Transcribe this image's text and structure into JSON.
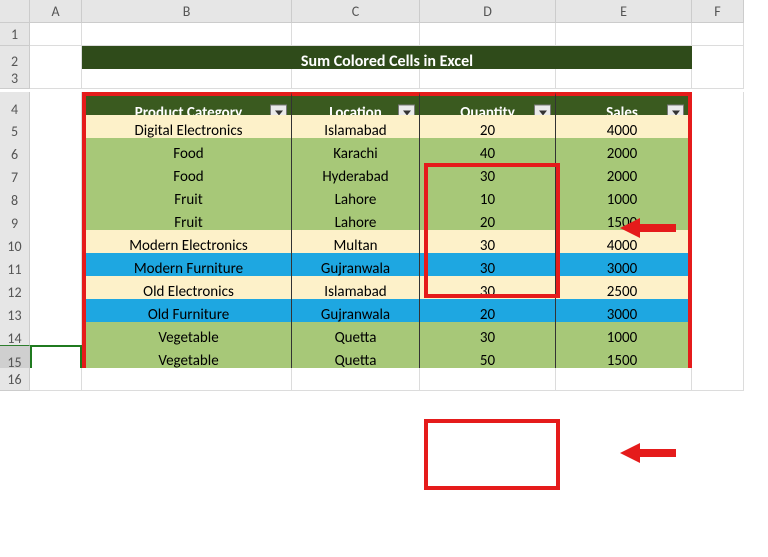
{
  "title": "Sum Colored Cells in Excel",
  "columns": [
    "",
    "A",
    "B",
    "C",
    "D",
    "E",
    "F"
  ],
  "row_indices": [
    "1",
    "2",
    "3",
    "4",
    "5",
    "6",
    "7",
    "8",
    "9",
    "10",
    "11",
    "12",
    "13",
    "14",
    "15",
    "16"
  ],
  "headers": {
    "b": "Product Category",
    "c": "Location",
    "d": "Quantity",
    "e": "Sales"
  },
  "rows": [
    {
      "cat": "Digital Electronics",
      "loc": "Islamabad",
      "qty": "20",
      "sales": "4000",
      "fill": "cream"
    },
    {
      "cat": "Food",
      "loc": "Karachi",
      "qty": "40",
      "sales": "2000",
      "fill": "green"
    },
    {
      "cat": "Food",
      "loc": "Hyderabad",
      "qty": "30",
      "sales": "2000",
      "fill": "green"
    },
    {
      "cat": "Fruit",
      "loc": "Lahore",
      "qty": "10",
      "sales": "1000",
      "fill": "green"
    },
    {
      "cat": "Fruit",
      "loc": "Lahore",
      "qty": "20",
      "sales": "1500",
      "fill": "green"
    },
    {
      "cat": "Modern Electronics",
      "loc": "Multan",
      "qty": "30",
      "sales": "4000",
      "fill": "cream"
    },
    {
      "cat": "Modern Furniture",
      "loc": "Gujranwala",
      "qty": "30",
      "sales": "3000",
      "fill": "blue"
    },
    {
      "cat": "Old Electronics",
      "loc": "Islamabad",
      "qty": "30",
      "sales": "2500",
      "fill": "cream"
    },
    {
      "cat": "Old Furniture",
      "loc": "Gujranwala",
      "qty": "20",
      "sales": "3000",
      "fill": "blue"
    },
    {
      "cat": "Vegetable",
      "loc": "Quetta",
      "qty": "30",
      "sales": "1000",
      "fill": "green"
    },
    {
      "cat": "Vegetable",
      "loc": "Quetta",
      "qty": "50",
      "sales": "1500",
      "fill": "green"
    }
  ],
  "chart_data": {
    "type": "table",
    "title": "Sum Colored Cells in Excel",
    "columns": [
      "Product Category",
      "Location",
      "Quantity",
      "Sales"
    ],
    "rows": [
      [
        "Digital Electronics",
        "Islamabad",
        20,
        4000
      ],
      [
        "Food",
        "Karachi",
        40,
        2000
      ],
      [
        "Food",
        "Hyderabad",
        30,
        2000
      ],
      [
        "Fruit",
        "Lahore",
        10,
        1000
      ],
      [
        "Fruit",
        "Lahore",
        20,
        1500
      ],
      [
        "Modern Electronics",
        "Multan",
        30,
        4000
      ],
      [
        "Modern Furniture",
        "Gujranwala",
        30,
        3000
      ],
      [
        "Old Electronics",
        "Islamabad",
        30,
        2500
      ],
      [
        "Old Furniture",
        "Gujranwala",
        20,
        3000
      ],
      [
        "Vegetable",
        "Quetta",
        30,
        1000
      ],
      [
        "Vegetable",
        "Quetta",
        50,
        1500
      ]
    ],
    "color_fill_per_row": [
      "cream",
      "green",
      "green",
      "green",
      "green",
      "cream",
      "blue",
      "cream",
      "blue",
      "green",
      "green"
    ]
  }
}
